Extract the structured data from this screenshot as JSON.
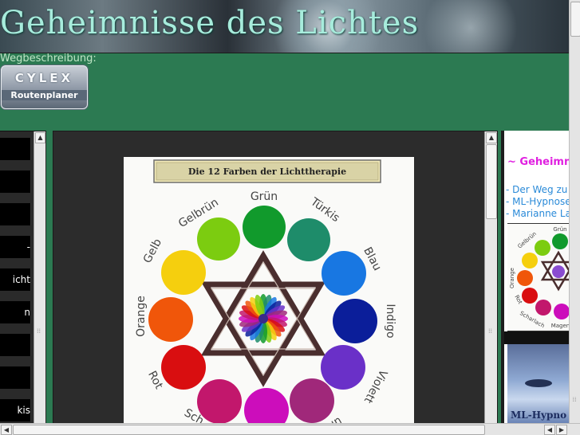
{
  "banner": {
    "title": "Geheimnisse des Lichtes"
  },
  "directions": {
    "label": "Wegbeschreibung:",
    "logo_text": "CYLEX",
    "button_label": "Routenplaner"
  },
  "left_nav": {
    "items": [
      {
        "label": ""
      },
      {
        "label": ""
      },
      {
        "label": ""
      },
      {
        "label": "-"
      },
      {
        "label": "icht"
      },
      {
        "label": "n"
      },
      {
        "label": ""
      },
      {
        "label": ""
      },
      {
        "label": "kis"
      }
    ]
  },
  "wheel": {
    "title": "Die 12 Farben der Lichttherapie",
    "colors": [
      {
        "name": "Grün",
        "hex": "#119a2c"
      },
      {
        "name": "Türkis",
        "hex": "#1e8c6a"
      },
      {
        "name": "Blau",
        "hex": "#1877e2"
      },
      {
        "name": "Indigo",
        "hex": "#0b1e9a"
      },
      {
        "name": "Violett",
        "hex": "#6a30c8"
      },
      {
        "name": "Purpur",
        "hex": "#a0287a"
      },
      {
        "name": "Magenta",
        "hex": "#cc0dbb"
      },
      {
        "name": "Scharlach",
        "hex": "#c2176c"
      },
      {
        "name": "Rot",
        "hex": "#d90e10"
      },
      {
        "name": "Orange",
        "hex": "#f0560a"
      },
      {
        "name": "Gelb",
        "hex": "#f5cf0e"
      },
      {
        "name": "Gelbrün",
        "hex": "#7ccc10"
      }
    ],
    "visible_labels": {
      "gruen": "Grün",
      "tuerkis": "Türkis",
      "blau": "Blau",
      "indigo": "Indigo",
      "violett": "Violett",
      "purpur": "ur",
      "scharlach": "Sch",
      "rot": "Rot",
      "orange": "Orange",
      "gelb": "Gelb",
      "gelbruen": "Gelbrün"
    }
  },
  "right_panel": {
    "title": "~ Geheimn",
    "links": [
      "- Der Weg zu n",
      "- ML-Hypnoset",
      "- Marianne Lan"
    ],
    "thumb_labels": {
      "top": "Grün",
      "left": "Gelbrün",
      "side": "Orange",
      "rot": "Rot",
      "sch": "Scharlach",
      "mag": "Magenta"
    },
    "photo_text": "ML-Hypno"
  },
  "scrollbars": {
    "up_arrow": "▲",
    "left_arrow": "◀",
    "right_arrow": "▶",
    "grip": "⁞⁞"
  }
}
